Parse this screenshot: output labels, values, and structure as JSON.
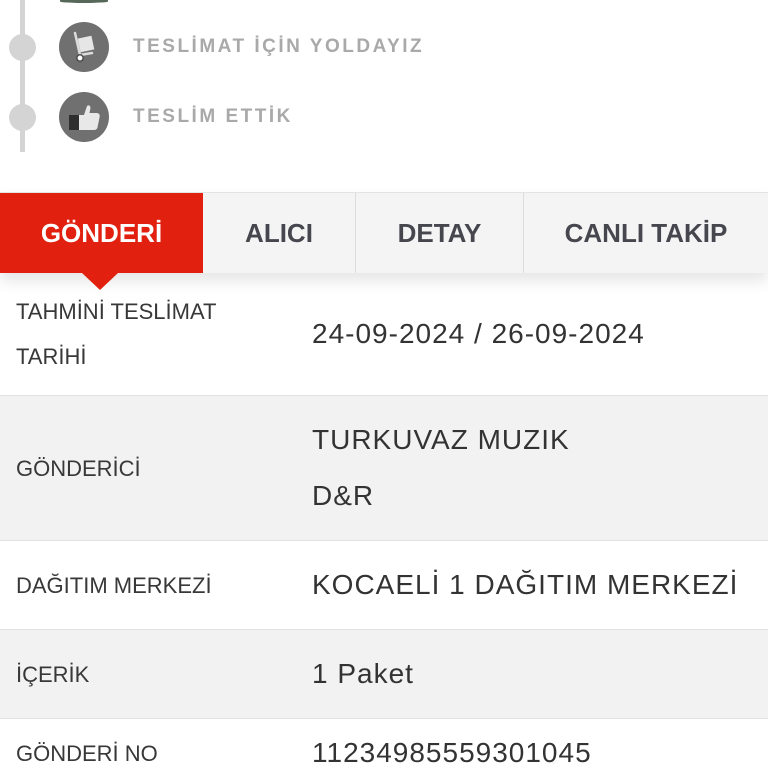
{
  "timeline": {
    "steps": [
      {
        "label": "TESLİMAT İÇİN YOLDAYIZ",
        "icon": "hand-truck-icon"
      },
      {
        "label": "TESLİM ETTİK",
        "icon": "thumbs-up-icon"
      }
    ]
  },
  "tabs": [
    {
      "label": "GÖNDERİ",
      "active": true
    },
    {
      "label": "ALICI",
      "active": false
    },
    {
      "label": "DETAY",
      "active": false
    },
    {
      "label": "CANLI TAKİP",
      "active": false
    }
  ],
  "details": {
    "rows": [
      {
        "label": "TAHMİNİ TESLİMAT TARİHİ",
        "values": [
          "24-09-2024 / 26-09-2024"
        ]
      },
      {
        "label": "GÖNDERİCİ",
        "values": [
          "TURKUVAZ MUZIK",
          "D&R"
        ]
      },
      {
        "label": "DAĞITIM MERKEZİ",
        "values": [
          "KOCAELİ 1 DAĞITIM MERKEZİ"
        ]
      },
      {
        "label": "İÇERİK",
        "values": [
          "1 Paket"
        ]
      },
      {
        "label": "GÖNDERİ NO",
        "values": [
          "11234985559301045"
        ]
      }
    ]
  },
  "colors": {
    "accent": "#e2200f",
    "timeline_inactive": "#d4d4d4",
    "step_icon_bg": "#707070",
    "previous_step_icon": "#55685a",
    "row_alt_bg": "#f2f2f2"
  }
}
